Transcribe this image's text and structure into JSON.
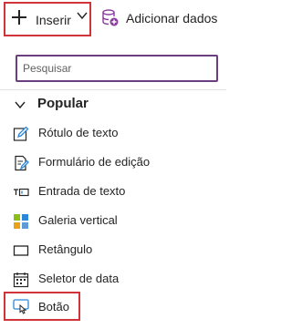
{
  "toolbar": {
    "insert_label": "Inserir",
    "add_data_label": "Adicionar dados"
  },
  "search": {
    "placeholder": "Pesquisar",
    "value": ""
  },
  "section": {
    "title": "Popular"
  },
  "items": [
    {
      "label": "Rótulo de texto",
      "icon": "edit-text-icon"
    },
    {
      "label": "Formulário de edição",
      "icon": "form-edit-icon"
    },
    {
      "label": "Entrada de texto",
      "icon": "text-input-icon"
    },
    {
      "label": "Galeria vertical",
      "icon": "gallery-icon"
    },
    {
      "label": "Retângulo",
      "icon": "rectangle-icon"
    },
    {
      "label": "Seletor de data",
      "icon": "calendar-icon"
    },
    {
      "label": "Botão",
      "icon": "button-icon"
    }
  ],
  "colors": {
    "highlight": "#d13438",
    "search_border": "#6b3f7f",
    "icon_accent": "#2b88d8",
    "data_icon": "#8a3d9e"
  }
}
